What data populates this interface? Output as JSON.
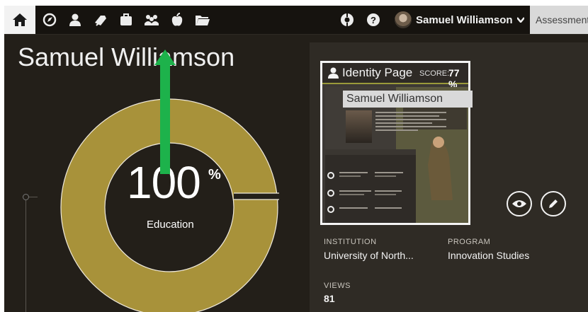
{
  "nav": {
    "user_name": "Samuel Williamson",
    "assessment_tab": "Assessment"
  },
  "profile": {
    "name": "Samuel Williamson",
    "education_percent": "100",
    "percent_sign": "%",
    "education_label": "Education"
  },
  "card": {
    "title": "Identity Page",
    "score_label": "SCORE:",
    "score_value": "77 %",
    "preview_name": "Samuel Williamson"
  },
  "details": {
    "institution_label": "INSTITUTION",
    "institution_value": "University of North...",
    "program_label": "PROGRAM",
    "program_value": "Innovation Studies",
    "views_label": "VIEWS",
    "views_value": "81"
  },
  "colors": {
    "donut": "#a8923a",
    "arrow": "#1db24b",
    "background": "#231f19"
  },
  "education_progress": 1.0
}
